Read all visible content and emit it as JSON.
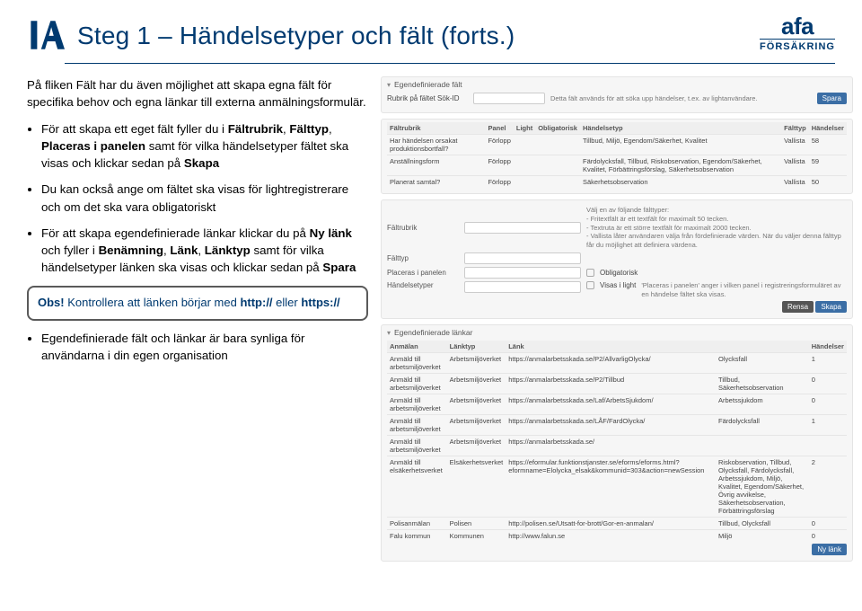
{
  "header": {
    "title": "Steg 1 – Händelsetyper och fält (forts.)",
    "afa_top": "afa",
    "afa_sub": "FÖRSÄKRING"
  },
  "left": {
    "intro": "På fliken Fält har du även möjlighet att skapa egna fält för specifika behov och egna länkar till externa anmälningsformulär.",
    "li1_a": "För att skapa ett eget fält fyller du i ",
    "li1_b": "Fältrubrik",
    "li1_c": ", ",
    "li1_d": "Fälttyp",
    "li1_e": ", ",
    "li1_f": "Placeras i panelen",
    "li1_g": " samt för vilka händelsetyper fältet ska visas och klickar sedan på ",
    "li1_h": "Skapa",
    "li2_a": "Du kan också ange om fältet ska visas för lightregistrerare och om det ska vara obligatoriskt",
    "li3_a": "För att skapa egendefinierade länkar klickar du på ",
    "li3_b": "Ny länk",
    "li3_c": " och fyller i ",
    "li3_d": "Benämning",
    "li3_e": ", ",
    "li3_f": "Länk",
    "li3_g": ", ",
    "li3_h": "Länktyp",
    "li3_i": " samt för vilka händelsetyper länken ska visas och klickar sedan på ",
    "li3_j": "Spara",
    "obs_a": "Obs!",
    "obs_b": " Kontrollera att länken börjar med ",
    "obs_c": "http://",
    "obs_d": " eller ",
    "obs_e": "https://",
    "li4": "Egendefinierade fält  och länkar är bara synliga för användarna i din egen organisation"
  },
  "p1": {
    "accordion": "Egendefinierade fält",
    "label": "Rubrik på fältet Sök-ID",
    "hint": "Detta fält används för att söka upp händelser, t.ex. av lightanvändare.",
    "save": "Spara"
  },
  "t1": {
    "h": [
      "Fältrubrik",
      "Panel",
      "Light",
      "Obligatorisk",
      "Händelsetyp",
      "Fälttyp",
      "Händelser"
    ],
    "rows": [
      [
        "Har händelsen orsakat produktionsbortfall?",
        "Förlopp",
        "",
        "",
        "Tillbud, Miljö, Egendom/Säkerhet, Kvalitet",
        "Vallista",
        "58"
      ],
      [
        "Anställningsform",
        "Förlopp",
        "",
        "",
        "Färdolycksfall, Tillbud, Riskobservation, Egendom/Säkerhet, Kvalitet, Förbättringsförslag, Säkerhetsobservation",
        "Vallista",
        "59"
      ],
      [
        "Planerat samtal?",
        "Förlopp",
        "",
        "",
        "Säkerhetsobservation",
        "Vallista",
        "50"
      ]
    ]
  },
  "form": {
    "l_rubrik": "Fältrubrik",
    "l_typ": "Fälttyp",
    "l_place": "Placeras i panelen",
    "l_ht": "Händelsetyper",
    "cb_obl": "Obligatorisk",
    "cb_light": "Visas i light",
    "hint1": "Välj en av följande fälttyper:\n- Fritextfält är ett textfält för maximalt 50 tecken.\n- Textruta är ett större textfält för maximalt 2000 tecken.\n- Vallista låter användaren välja från fördefinierade värden. När du väljer denna fälttyp får du möjlighet att definiera värdena.",
    "hint2": "'Placeras i panelen' anger i vilken panel i registreringsformuläret av en händelse fältet ska visas.",
    "btn_clear": "Rensa",
    "btn_create": "Skapa"
  },
  "p3": {
    "accordion": "Egendefinierade länkar"
  },
  "t2": {
    "h": [
      "Anmälan",
      "Länktyp",
      "Länk",
      "",
      "Händelser"
    ],
    "rows": [
      [
        "Anmäld till arbetsmiljöverket",
        "Arbetsmiljöverket",
        "https://anmalarbetsskada.se/P2/AllvarligOlycka/",
        "Olycksfall",
        "1"
      ],
      [
        "Anmäld till arbetsmiljöverket",
        "Arbetsmiljöverket",
        "https://anmalarbetsskada.se/P2/Tillbud",
        "Tillbud, Säkerhetsobservation",
        "0"
      ],
      [
        "Anmäld till arbetsmiljöverket",
        "Arbetsmiljöverket",
        "https://anmalarbetsskada.se/Laf/ArbetsSjukdom/",
        "Arbetssjukdom",
        "0"
      ],
      [
        "Anmäld till arbetsmiljöverket",
        "Arbetsmiljöverket",
        "https://anmalarbetsskada.se/LÅF/FardOlycka/",
        "Färdolycksfall",
        "1"
      ],
      [
        "Anmäld till arbetsmiljöverket",
        "Arbetsmiljöverket",
        "https://anmalarbetsskada.se/",
        "",
        ""
      ],
      [
        "Anmäld till elsäkerhetsverket",
        "Elsäkerhetsverket",
        "https://eformular.funktionstjanster.se/eforms/eforms.html?eformname=Elolycka_elsak&kommunid=303&action=newSession",
        "Riskobservation, Tillbud, Olycksfall, Färdolycksfall, Arbetssjukdom, Miljö, Kvalitet, Egendom/Säkerhet, Övrig avvikelse, Säkerhetsobservation, Förbättringsförslag",
        "2"
      ],
      [
        "Polisanmälan",
        "Polisen",
        "http://polisen.se/Utsatt-for-brott/Gor-en-anmalan/",
        "Tillbud, Olycksfall",
        "0"
      ],
      [
        "Falu kommun",
        "Kommunen",
        "http://www.falun.se",
        "Miljö",
        "0"
      ]
    ]
  },
  "btn_newlink": "Ny länk"
}
